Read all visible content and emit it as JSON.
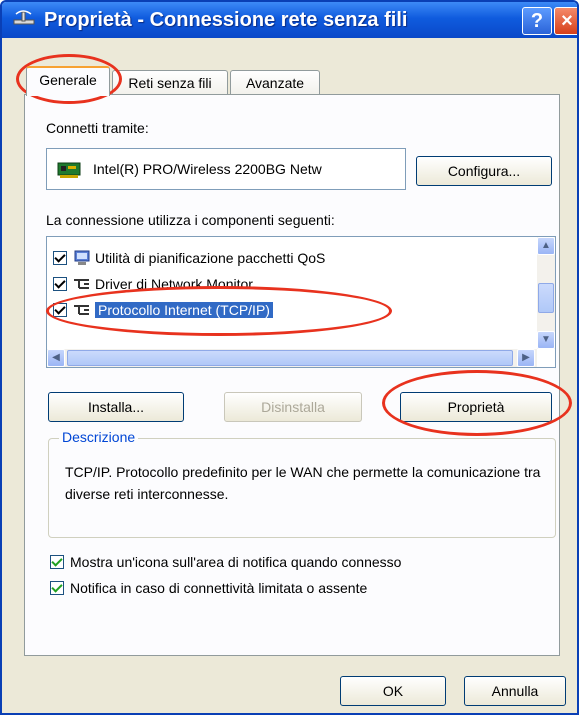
{
  "window": {
    "title": "Proprietà - Connessione rete senza fili",
    "help_button": "?",
    "close_button": "×"
  },
  "tabs": [
    {
      "label": "Generale",
      "active": true
    },
    {
      "label": "Reti senza fili",
      "active": false
    },
    {
      "label": "Avanzate",
      "active": false
    }
  ],
  "connect_via": {
    "label": "Connetti tramite:",
    "adapter": "Intel(R) PRO/Wireless 2200BG Netw",
    "configure_button": "Configura..."
  },
  "components": {
    "label": "La connessione utilizza i componenti seguenti:",
    "items": [
      {
        "label": "Utilità di pianificazione pacchetti QoS",
        "checked": true,
        "icon": "scheduler-icon"
      },
      {
        "label": "Driver di Network Monitor",
        "checked": true,
        "icon": "network-protocol-icon"
      },
      {
        "label": "Protocollo Internet (TCP/IP)",
        "checked": true,
        "selected": true,
        "icon": "network-protocol-icon"
      }
    ]
  },
  "buttons": {
    "install": "Installa...",
    "uninstall": "Disinstalla",
    "properties": "Proprietà",
    "ok": "OK",
    "cancel": "Annulla"
  },
  "description": {
    "legend": "Descrizione",
    "text": "TCP/IP. Protocollo predefinito per le WAN che permette la comunicazione tra diverse reti interconnesse."
  },
  "options": [
    {
      "label": "Mostra un'icona sull'area di notifica quando connesso",
      "checked": true
    },
    {
      "label": "Notifica in caso di connettività limitata o assente",
      "checked": true
    }
  ],
  "colors": {
    "titlebar": "#0a48c8",
    "dialog_bg": "#ece9d8",
    "selection": "#316ac5",
    "annotation_circle": "#e8321e",
    "active_tab_accent": "#f7a233"
  }
}
